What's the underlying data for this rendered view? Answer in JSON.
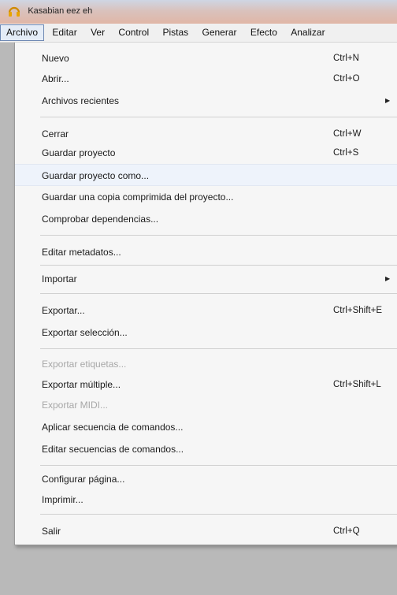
{
  "window": {
    "title": "Kasabian    eez eh",
    "icon": "headphones-icon"
  },
  "menubar": {
    "items": [
      "Archivo",
      "Editar",
      "Ver",
      "Control",
      "Pistas",
      "Generar",
      "Efecto",
      "Analizar"
    ]
  },
  "menu": {
    "nuevo": {
      "label": "Nuevo",
      "shortcut": "Ctrl+N"
    },
    "abrir": {
      "label": "Abrir...",
      "shortcut": "Ctrl+O"
    },
    "recientes": {
      "label": "Archivos recientes"
    },
    "cerrar": {
      "label": "Cerrar",
      "shortcut": "Ctrl+W"
    },
    "guardar": {
      "label": "Guardar proyecto",
      "shortcut": "Ctrl+S"
    },
    "guardar_como": {
      "label": "Guardar proyecto como..."
    },
    "copia_comprimida": {
      "label": "Guardar una copia comprimida del proyecto..."
    },
    "dependencias": {
      "label": "Comprobar dependencias..."
    },
    "metadatos": {
      "label": "Editar metadatos..."
    },
    "importar": {
      "label": "Importar"
    },
    "exportar": {
      "label": "Exportar...",
      "shortcut": "Ctrl+Shift+E"
    },
    "exportar_seleccion": {
      "label": "Exportar selección..."
    },
    "exportar_etiquetas": {
      "label": "Exportar etiquetas..."
    },
    "exportar_multiple": {
      "label": "Exportar múltiple...",
      "shortcut": "Ctrl+Shift+L"
    },
    "exportar_midi": {
      "label": "Exportar MIDI..."
    },
    "aplicar_secuencia": {
      "label": "Aplicar secuencia de comandos..."
    },
    "editar_secuencias": {
      "label": "Editar secuencias de comandos..."
    },
    "configurar_pagina": {
      "label": "Configurar página..."
    },
    "imprimir": {
      "label": "Imprimir..."
    },
    "salir": {
      "label": "Salir",
      "shortcut": "Ctrl+Q"
    }
  },
  "colors": {
    "highlight": "#eef3fb",
    "disabled_text": "#a7a7a7",
    "menu_bg": "#f6f6f6"
  }
}
